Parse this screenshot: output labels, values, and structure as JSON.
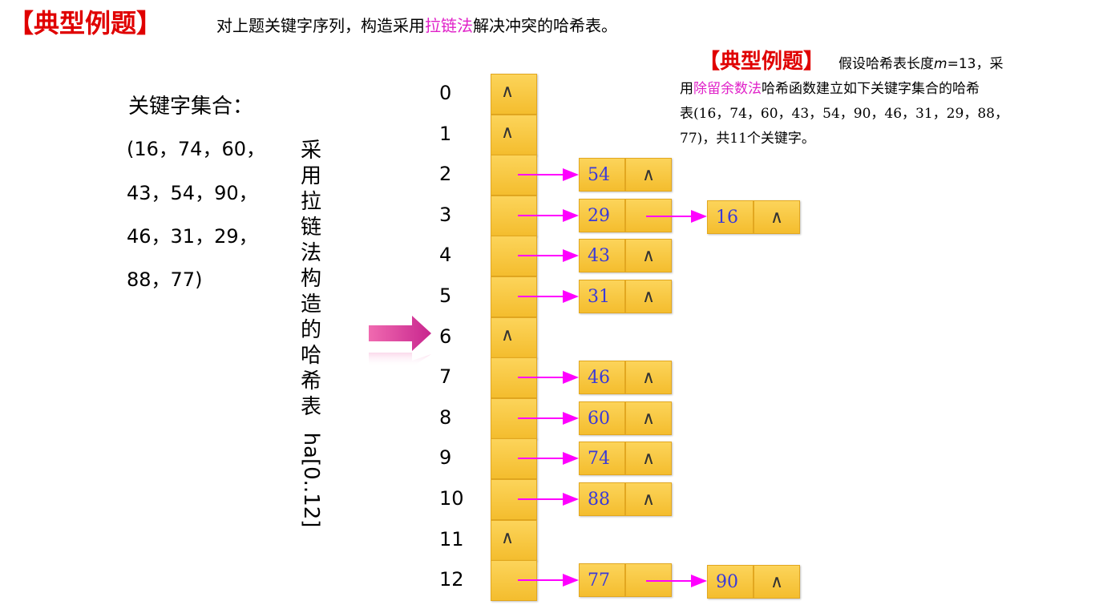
{
  "header": {
    "bracket_title": "【典型例题】",
    "question_pre": "对上题关键字序列，构造采用",
    "question_highlight": "拉链法",
    "question_post": "解决冲突的哈希表。"
  },
  "side_note": {
    "bracket_title": "【典型例题】",
    "line1_pre": "假设哈希表长度",
    "line1_var": "m",
    "line1_post": "=13，采",
    "line2_pre": "用",
    "line2_highlight": "除留余数法",
    "line2_post": "哈希函数建立如下关键字集合的哈希",
    "line3": "表(16，74，60，43，54，90，46，31，29，88，",
    "line4": "77)，共11个关键字。"
  },
  "key_set": {
    "label": "关键字集合：",
    "lines": [
      "(16，74，60，",
      "43，54，90，",
      "46，31，29，",
      "88，77)"
    ]
  },
  "vertical_label": {
    "chars": [
      "采",
      "用",
      "拉",
      "链",
      "法",
      "构",
      "造",
      "的",
      "哈",
      "希",
      "表"
    ],
    "suffix": "ha[0..12]"
  },
  "nil_symbol": "∧",
  "chart_data": {
    "type": "hash_table_chaining",
    "slots": [
      {
        "index": "0",
        "chain": []
      },
      {
        "index": "1",
        "chain": []
      },
      {
        "index": "2",
        "chain": [
          "54"
        ]
      },
      {
        "index": "3",
        "chain": [
          "29",
          "16"
        ]
      },
      {
        "index": "4",
        "chain": [
          "43"
        ]
      },
      {
        "index": "5",
        "chain": [
          "31"
        ]
      },
      {
        "index": "6",
        "chain": []
      },
      {
        "index": "7",
        "chain": [
          "46"
        ]
      },
      {
        "index": "8",
        "chain": [
          "60"
        ]
      },
      {
        "index": "9",
        "chain": [
          "74"
        ]
      },
      {
        "index": "10",
        "chain": [
          "88"
        ]
      },
      {
        "index": "11",
        "chain": []
      },
      {
        "index": "12",
        "chain": [
          "77",
          "90"
        ]
      }
    ]
  },
  "colors": {
    "title_red": "#e00000",
    "highlight_magenta": "#e020c8",
    "arrow_magenta": "#ff00ff",
    "node_fill": "#f7c53f",
    "key_blue": "#3a3ad8"
  }
}
